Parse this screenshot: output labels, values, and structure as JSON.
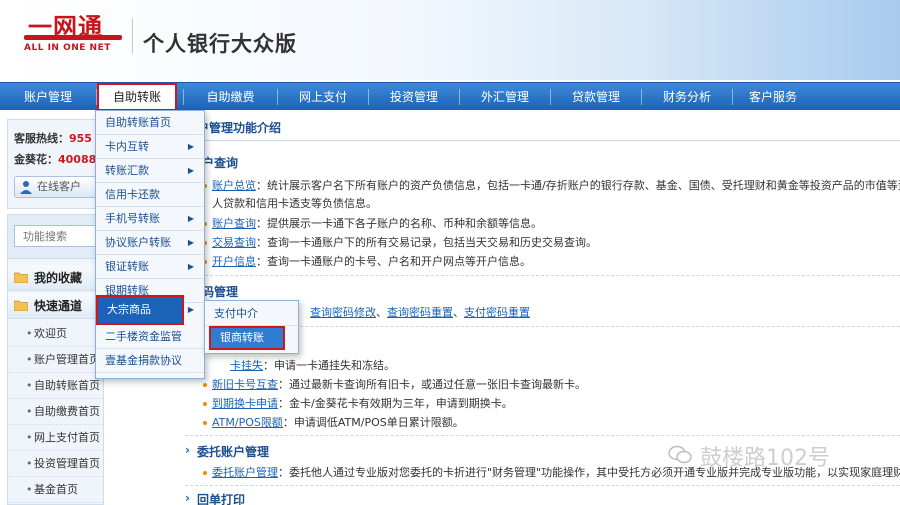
{
  "header": {
    "logo_text": "一网通",
    "logo_sub": "ALL IN ONE NET",
    "site_title": "个人银行大众版"
  },
  "nav": {
    "items": [
      "账户管理",
      "自助转账",
      "自助缴费",
      "网上支付",
      "投资管理",
      "外汇管理",
      "贷款管理",
      "财务分析",
      "客户服务"
    ],
    "active": "自助转账"
  },
  "sidebar": {
    "hotline_label": "客服热线：",
    "hotline_value": "955",
    "jinkui_label": "金葵花：",
    "jinkui_value": "40088",
    "online_button": "在线客户",
    "search_placeholder": "功能搜索",
    "favorites": "我的收藏",
    "quick": "快速通道",
    "quick_items": [
      "欢迎页",
      "账户管理首页",
      "自助转账首页",
      "自助缴费首页",
      "网上支付首页",
      "投资管理首页",
      "基金首页"
    ]
  },
  "dropdown": {
    "items": [
      {
        "label": "自助转账首页",
        "arrow": ""
      },
      {
        "label": "卡内互转",
        "arrow": "▶"
      },
      {
        "label": "转账汇款",
        "arrow": "▶"
      },
      {
        "label": "信用卡还款",
        "arrow": ""
      },
      {
        "label": "手机号转账",
        "arrow": "▶"
      },
      {
        "label": "协议账户转账",
        "arrow": "▶"
      },
      {
        "label": "银证转账",
        "arrow": "▶"
      },
      {
        "label": "银期转账",
        "arrow": ""
      },
      {
        "label": "大宗商品",
        "arrow": "▶"
      },
      {
        "label": "二手楼资金监管",
        "arrow": ""
      },
      {
        "label": "壹基金捐款协议",
        "arrow": ""
      }
    ],
    "active_index": 8,
    "submenu": [
      "支付中介",
      "银商转账"
    ],
    "submenu_active": 1
  },
  "content": {
    "title": "账户管理功能介绍",
    "sec1_title": "户查询",
    "sec1_rows": [
      {
        "link": "账户总览",
        "text": "：统计展示客户名下所有账户的资产负债信息，包括一卡通/存折账户的银行存款、基金、国债、受托理财和黄金等投资产品的市值等资"
      },
      {
        "link": "",
        "text": "人贷款和信用卡透支等负债信息。"
      },
      {
        "link": "账户查询",
        "text": "：提供展示一卡通下各子账户的名称、币种和余额等信息。"
      },
      {
        "link": "交易查询",
        "text": "：查询一卡通账户下的所有交易记录，包括当天交易和历史交易查询。"
      },
      {
        "link": "开户信息",
        "text": "：查询一卡通账户的卡号、户名和开户网点等开户信息。"
      }
    ],
    "sec2_title": "码管理",
    "sec2_links": [
      "查询密码修改",
      "查询密码重置",
      "支付密码重置"
    ],
    "sec3_rows": [
      {
        "link": "卡挂失",
        "text": "：申请一卡通挂失和冻结。"
      },
      {
        "link": "新旧卡号互查",
        "text": "：通过最新卡查询所有旧卡，或通过任意一张旧卡查询最新卡。"
      },
      {
        "link": "到期换卡申请",
        "text": "：金卡/金葵花卡有效期为三年，申请到期换卡。"
      },
      {
        "link": "ATM/POS限额",
        "text": "：申请调低ATM/POS单日累计限额。"
      }
    ],
    "sec4_title": "委托账户管理",
    "sec4_row": {
      "link": "委托账户管理",
      "text": "：委托他人通过专业版对您委托的卡折进行\"财务管理\"功能操作，其中受托方必须开通专业版并完成专业版功能，以实现家庭理财的"
    },
    "sec5_title": "回单打印"
  },
  "watermark": "鼓楼路102号"
}
